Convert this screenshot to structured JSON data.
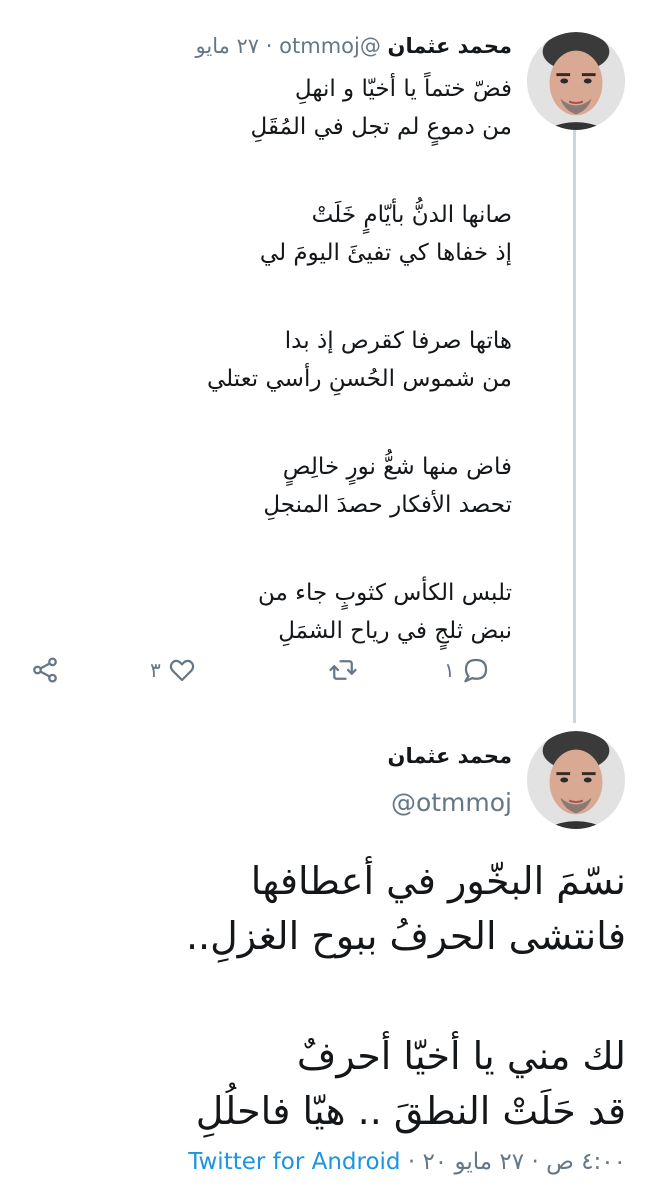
{
  "tweet1": {
    "name": "محمد عثمان",
    "handle": "@otmmoj",
    "separator": "·",
    "date": "٢٧ مايو",
    "stanzas": [
      [
        "فضّ ختماً يا أخيّا و انهلِ",
        "من دموعٍ لم تجل في المُقَلِ"
      ],
      [
        "صانها الدنُّ بأيّامٍ خَلَتْ",
        "إذ خفاها كي تفيئَ اليومَ لي"
      ],
      [
        "هاتها صرفا كقرص إذ بدا",
        "من شموس الحُسنِ رأسي تعتلي"
      ],
      [
        "فاض منها شعُّ نورٍ خالِصٍ",
        "تحصد الأفكار حصدَ المنجلِ"
      ],
      [
        "تلبس الكأس كثوبٍ جاء من",
        "نبض ثلجٍ في رياح الشمَلِ"
      ]
    ],
    "actions": {
      "reply_count": "١",
      "like_count": "٣",
      "reply_icon": "reply-icon",
      "retweet_icon": "retweet-icon",
      "like_icon": "heart-icon",
      "share_icon": "share-icon"
    }
  },
  "tweet2": {
    "name": "محمد عثمان",
    "handle": "@otmmoj",
    "stanzas": [
      [
        "نسّمَ البخّور في أعطافها",
        "فانتشى الحرفُ ببوح الغزلِ.."
      ],
      [
        "لك مني يا أخيّا أحرفٌ",
        "قد حَلَتْ النطقَ .. هيّا فاحلُلِ"
      ]
    ],
    "time": "٤:٠٠ ص",
    "date": "٢٧ مايو ٢٠",
    "separator": "·",
    "source": "Twitter for Android"
  },
  "colors": {
    "primary_text": "#14171a",
    "secondary_text": "#657786",
    "link": "#1b95e0",
    "thread_line": "#ccd6dd"
  }
}
